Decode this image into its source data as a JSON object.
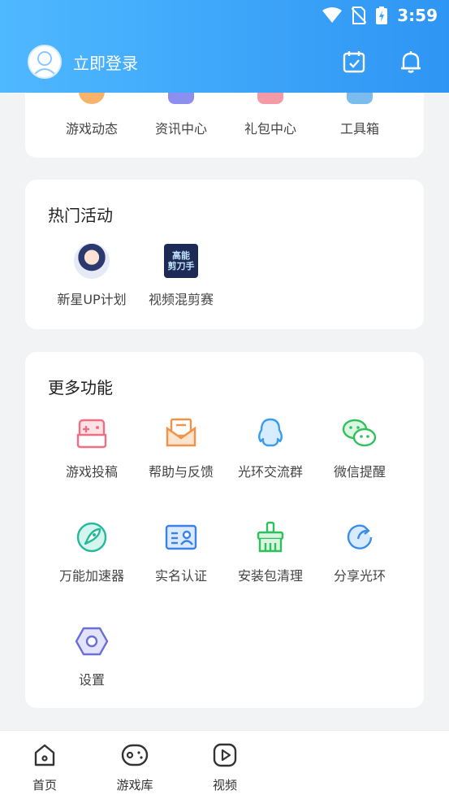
{
  "status": {
    "time": "3:59"
  },
  "header": {
    "login_text": "立即登录",
    "accent": "#2f95f4"
  },
  "top_section": {
    "items": [
      {
        "label": "游戏动态",
        "icon": "game-news-icon"
      },
      {
        "label": "资讯中心",
        "icon": "news-center-icon"
      },
      {
        "label": "礼包中心",
        "icon": "gift-center-icon"
      },
      {
        "label": "工具箱",
        "icon": "toolbox-icon"
      }
    ]
  },
  "hot": {
    "title": "热门活动",
    "items": [
      {
        "label": "新星UP计划",
        "icon": "new-star-up-thumb"
      },
      {
        "label": "视频混剪赛",
        "icon": "video-remix-thumb",
        "thumb_text_1": "高能",
        "thumb_text_2": "剪刀手"
      }
    ]
  },
  "more": {
    "title": "更多功能",
    "items": [
      {
        "label": "游戏投稿",
        "icon": "game-submit-icon"
      },
      {
        "label": "帮助与反馈",
        "icon": "help-feedback-icon"
      },
      {
        "label": "光环交流群",
        "icon": "qq-group-icon"
      },
      {
        "label": "微信提醒",
        "icon": "wechat-icon"
      },
      {
        "label": "万能加速器",
        "icon": "rocket-accelerator-icon"
      },
      {
        "label": "实名认证",
        "icon": "id-card-icon"
      },
      {
        "label": "安装包清理",
        "icon": "broom-clean-icon"
      },
      {
        "label": "分享光环",
        "icon": "share-icon"
      },
      {
        "label": "设置",
        "icon": "settings-hex-icon"
      }
    ]
  },
  "tabbar": {
    "items": [
      {
        "label": "首页",
        "icon": "home-icon"
      },
      {
        "label": "游戏库",
        "icon": "game-library-icon"
      },
      {
        "label": "视频",
        "icon": "video-play-icon"
      }
    ]
  }
}
